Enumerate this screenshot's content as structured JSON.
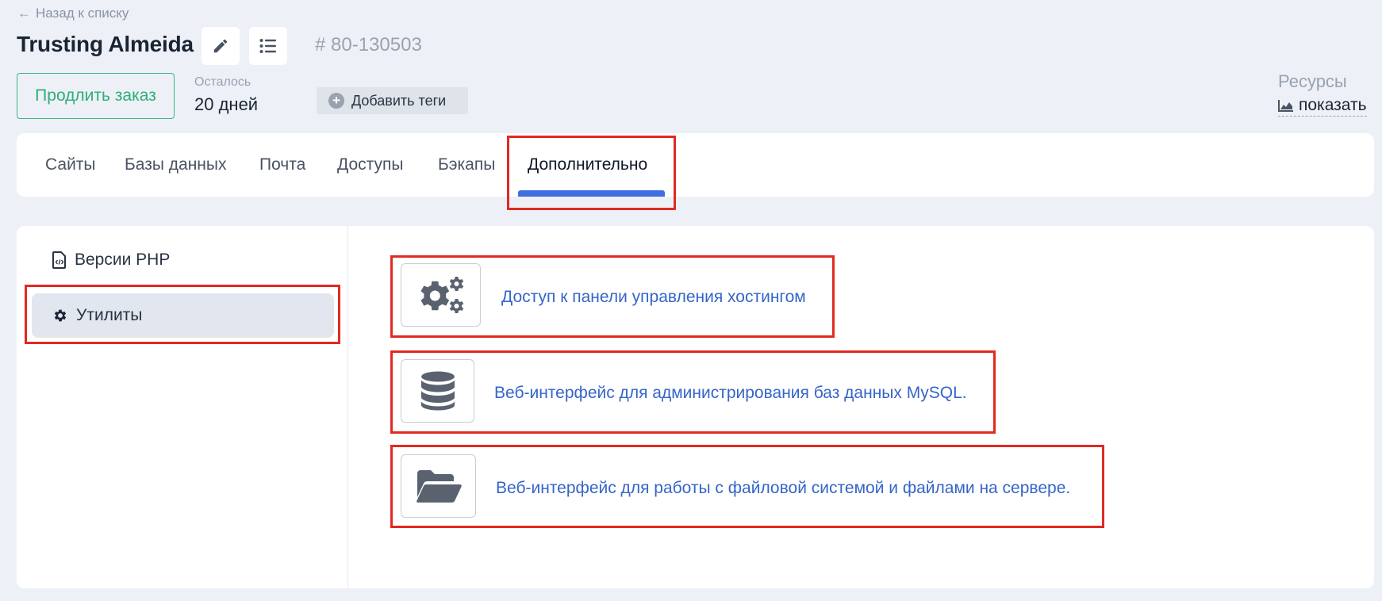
{
  "header": {
    "back_label": "Назад к списку",
    "title": "Trusting Almeida",
    "order_id": "# 80-130503",
    "extend_label": "Продлить заказ",
    "remain_label": "Осталось",
    "remain_value": "20 дней",
    "tags_label": "Добавить теги",
    "resources_label": "Ресурсы",
    "resources_show": "показать"
  },
  "tabs": [
    {
      "label": "Сайты"
    },
    {
      "label": "Базы данных"
    },
    {
      "label": "Почта"
    },
    {
      "label": "Доступы"
    },
    {
      "label": "Бэкапы"
    },
    {
      "label": "Дополнительно",
      "active": true
    }
  ],
  "sidebar": {
    "items": [
      {
        "label": "Версии PHP",
        "icon": "php-file-icon"
      },
      {
        "label": "Утилиты",
        "icon": "gear-icon",
        "active": true
      }
    ]
  },
  "tools": [
    {
      "label": "Доступ к панели управления хостингом",
      "icon": "gears-icon"
    },
    {
      "label": "Веб-интерфейс для администрирования баз данных MySQL.",
      "icon": "database-icon"
    },
    {
      "label": "Веб-интерфейс для работы с файловой системой и файлами на сервере.",
      "icon": "folder-open-icon"
    }
  ],
  "colors": {
    "accent_blue": "#3f6ee0",
    "link_blue": "#3565c8",
    "success_green": "#2fae75",
    "highlight_red": "#e02a22"
  }
}
